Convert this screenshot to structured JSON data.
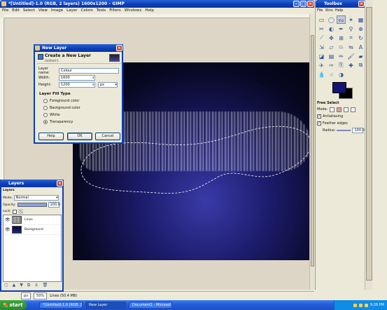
{
  "main_window": {
    "title": "*[Untitled]-1.0 (RGB, 2 layers) 1600x1200 – GIMP",
    "menu": [
      "File",
      "Edit",
      "Select",
      "View",
      "Image",
      "Layer",
      "Colors",
      "Tools",
      "Filters",
      "Windows",
      "Help"
    ],
    "status": {
      "unit": "px",
      "zoom": "50%",
      "layer_info": "Lines (50.4 MB)"
    }
  },
  "toolbox": {
    "title": "Toolbox",
    "tools": [
      "rect-select",
      "ellipse-select",
      "free-select",
      "fuzzy-select",
      "by-color-select",
      "scissors",
      "foreground-select",
      "paths",
      "color-picker",
      "zoom",
      "measure",
      "move",
      "align",
      "crop",
      "rotate",
      "scale",
      "shear",
      "perspective",
      "flip",
      "text",
      "bucket-fill",
      "blend",
      "pencil",
      "paintbrush",
      "eraser",
      "airbrush",
      "ink",
      "clone",
      "heal",
      "perspective-clone",
      "convolve",
      "smudge",
      "dodge-burn"
    ],
    "active_tool": "free-select",
    "fg_color": "#171372",
    "bg_color": "#000000"
  },
  "tool_options": {
    "title": "Free Select",
    "mode_label": "Mode:",
    "antialiasing": "Antialiasing",
    "feather": "Feather edges",
    "radius_label": "Radius:",
    "radius_value": "100.0"
  },
  "new_layer_dialog": {
    "title": "New Layer",
    "heading": "Create a New Layer",
    "subheading": "Untitled-1",
    "name_label": "Layer name:",
    "name_value": "Colour",
    "width_label": "Width:",
    "width_value": "1600",
    "height_label": "Height:",
    "height_value": "1200",
    "unit": "px",
    "fill_heading": "Layer Fill Type",
    "fill_options": [
      "Foreground color",
      "Background color",
      "White",
      "Transparency"
    ],
    "fill_selected": "Transparency",
    "help": "Help",
    "ok": "OK",
    "cancel": "Cancel"
  },
  "layers_panel": {
    "title": "Layers",
    "tab": "Layers",
    "mode_label": "Mode:",
    "mode_value": "Normal",
    "opacity_label": "Opacity:",
    "opacity_value": "100.0",
    "lock_label": "Lock:",
    "layers": [
      {
        "name": "Lines"
      },
      {
        "name": "Background"
      }
    ]
  },
  "taskbar": {
    "start": "start",
    "tasks": [
      "*[Untitled]-1.0 (RGB, 2...",
      "New Layer",
      "Document1 - Microsof..."
    ],
    "active_task": "New Layer",
    "time": "9:28 PM"
  }
}
